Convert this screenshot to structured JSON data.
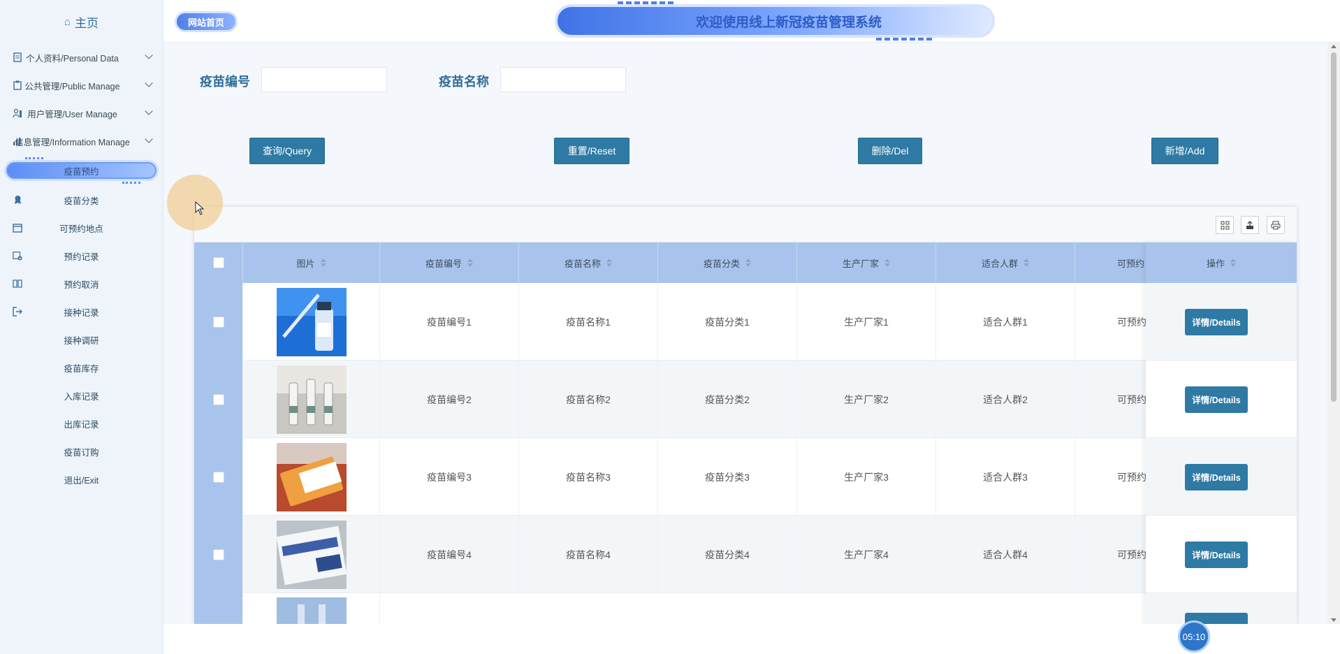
{
  "sidebar": {
    "home": "主页",
    "groups": [
      {
        "label": "个人资料/Personal Data"
      },
      {
        "label": "公共管理/Public Manage"
      },
      {
        "label": "用户管理/User Manage"
      },
      {
        "label": "信息管理/Information Manage"
      }
    ],
    "items": [
      {
        "label": "疫苗预约",
        "icon": "",
        "active": true
      },
      {
        "label": "疫苗分类",
        "icon": "badge-icon"
      },
      {
        "label": "可预约地点",
        "icon": "calendar-icon"
      },
      {
        "label": "预约记录",
        "icon": "calendar-check-icon"
      },
      {
        "label": "预约取消",
        "icon": "book-icon"
      },
      {
        "label": "接种记录",
        "icon": "logout-icon"
      },
      {
        "label": "接种调研",
        "icon": ""
      },
      {
        "label": "疫苗库存",
        "icon": ""
      },
      {
        "label": "入库记录",
        "icon": ""
      },
      {
        "label": "出库记录",
        "icon": ""
      },
      {
        "label": "疫苗订购",
        "icon": ""
      },
      {
        "label": "退出/Exit",
        "icon": ""
      }
    ]
  },
  "header": {
    "home_badge": "网站首页",
    "banner_title": "欢迎使用线上新冠疫苗管理系统"
  },
  "search": {
    "code_label": "疫苗编号",
    "code_value": "",
    "name_label": "疫苗名称",
    "name_value": "",
    "query": "查询/Query",
    "reset": "重置/Reset",
    "delete": "删除/Del",
    "add": "新增/Add"
  },
  "table": {
    "headers": [
      "图片",
      "疫苗编号",
      "疫苗名称",
      "疫苗分类",
      "生产厂家",
      "适合人群",
      "可预约"
    ],
    "ops_header": "操作",
    "rows": [
      {
        "code": "疫苗编号1",
        "name": "疫苗名称1",
        "cat": "疫苗分类1",
        "maker": "生产厂家1",
        "people": "适合人群1",
        "avail": "可预约"
      },
      {
        "code": "疫苗编号2",
        "name": "疫苗名称2",
        "cat": "疫苗分类2",
        "maker": "生产厂家2",
        "people": "适合人群2",
        "avail": "可预约"
      },
      {
        "code": "疫苗编号3",
        "name": "疫苗名称3",
        "cat": "疫苗分类3",
        "maker": "生产厂家3",
        "people": "适合人群3",
        "avail": "可预约"
      },
      {
        "code": "疫苗编号4",
        "name": "疫苗名称4",
        "cat": "疫苗分类4",
        "maker": "生产厂家4",
        "people": "适合人群4",
        "avail": "可预约"
      }
    ],
    "detail_label": "详情/Details"
  },
  "timer": "05:10",
  "colors": {
    "primary": "#2e7aa4",
    "header_bg": "#a9c4ec",
    "accent": "#5b8df5"
  }
}
